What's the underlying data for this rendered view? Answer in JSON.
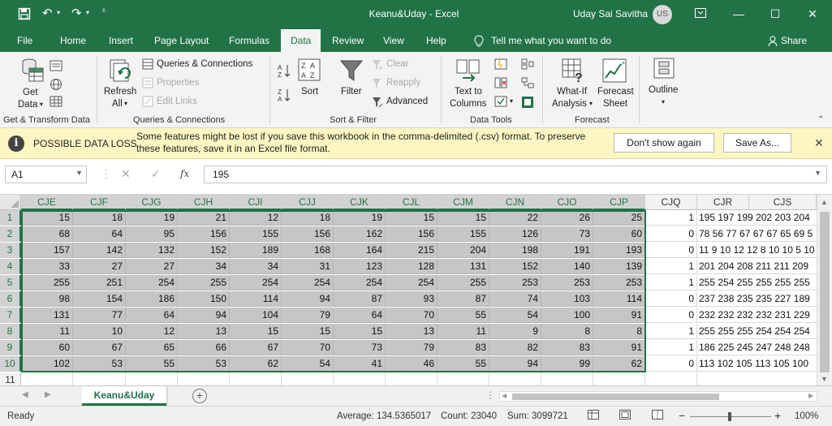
{
  "window": {
    "title": "Keanu&Uday  -  Excel",
    "user_name": "Uday Sai Savitha",
    "user_initials": "US"
  },
  "menu": {
    "file": "File",
    "home": "Home",
    "insert": "Insert",
    "page_layout": "Page Layout",
    "formulas": "Formulas",
    "data": "Data",
    "review": "Review",
    "view": "View",
    "help": "Help",
    "tell_me": "Tell me what you want to do",
    "share": "Share"
  },
  "ribbon": {
    "get_data": "Get",
    "get_data2": "Data",
    "group_get_transform": "Get & Transform Data",
    "refresh": "Refresh",
    "refresh_all": "All",
    "queries_connections": "Queries & Connections",
    "properties": "Properties",
    "edit_links": "Edit Links",
    "group_queries": "Queries & Connections",
    "sort": "Sort",
    "filter": "Filter",
    "clear": "Clear",
    "reapply": "Reapply",
    "advanced": "Advanced",
    "group_sort_filter": "Sort & Filter",
    "text_to_columns": "Text to",
    "text_to_columns2": "Columns",
    "group_data_tools": "Data Tools",
    "what_if": "What-If",
    "what_if2": "Analysis",
    "forecast_sheet": "Forecast",
    "forecast_sheet2": "Sheet",
    "group_forecast": "Forecast",
    "outline": "Outline"
  },
  "message_bar": {
    "title": "POSSIBLE DATA LOSS",
    "text": "Some features might be lost if you save this workbook in the comma-delimited (.csv) format. To preserve these features, save it in an Excel file format.",
    "dont_show": "Don't show again",
    "save_as": "Save As..."
  },
  "formula_bar": {
    "name_box": "A1",
    "formula": "195"
  },
  "grid": {
    "columns": [
      "CJE",
      "CJF",
      "CJG",
      "CJH",
      "CJI",
      "CJJ",
      "CJK",
      "CJL",
      "CJM",
      "CJN",
      "CJO",
      "CJP",
      "CJQ",
      "CJR",
      "CJS"
    ],
    "rows": [
      "1",
      "2",
      "3",
      "4",
      "5",
      "6",
      "7",
      "8",
      "9",
      "10",
      "11"
    ],
    "data": [
      [
        "15",
        "18",
        "19",
        "21",
        "12",
        "18",
        "19",
        "15",
        "15",
        "22",
        "26",
        "25",
        "1",
        "195 197 199 202 203 204"
      ],
      [
        "68",
        "64",
        "95",
        "156",
        "155",
        "156",
        "162",
        "156",
        "155",
        "126",
        "73",
        "60",
        "0",
        "78 56 77 67 67 67 65 69 5"
      ],
      [
        "157",
        "142",
        "132",
        "152",
        "189",
        "168",
        "164",
        "215",
        "204",
        "198",
        "191",
        "193",
        "0",
        "11 9 10 12 12 8 10 10 5 10"
      ],
      [
        "33",
        "27",
        "27",
        "34",
        "34",
        "31",
        "123",
        "128",
        "131",
        "152",
        "140",
        "139",
        "1",
        "201 204 208 211 211 209"
      ],
      [
        "255",
        "251",
        "254",
        "255",
        "254",
        "254",
        "254",
        "254",
        "255",
        "253",
        "253",
        "253",
        "1",
        "255 254 255 255 255 255"
      ],
      [
        "98",
        "154",
        "186",
        "150",
        "114",
        "94",
        "87",
        "93",
        "87",
        "74",
        "103",
        "114",
        "0",
        "237 238 235 235 227 189"
      ],
      [
        "131",
        "77",
        "64",
        "94",
        "104",
        "79",
        "64",
        "70",
        "55",
        "54",
        "100",
        "91",
        "0",
        "232 232 232 232 231 229"
      ],
      [
        "11",
        "10",
        "12",
        "13",
        "15",
        "15",
        "15",
        "13",
        "11",
        "9",
        "8",
        "8",
        "1",
        "255 255 255 254 254 254"
      ],
      [
        "60",
        "67",
        "65",
        "66",
        "67",
        "70",
        "73",
        "79",
        "83",
        "82",
        "83",
        "91",
        "1",
        "186 225 245 247 248 248"
      ],
      [
        "102",
        "53",
        "55",
        "53",
        "62",
        "54",
        "41",
        "46",
        "55",
        "94",
        "99",
        "62",
        "0",
        "113 102 105 113 105 100"
      ]
    ]
  },
  "sheet": {
    "tab_name": "Keanu&Uday"
  },
  "status": {
    "ready": "Ready",
    "average": "Average: 134.5365017",
    "count": "Count: 23040",
    "sum": "Sum: 3099721",
    "zoom": "100%"
  }
}
